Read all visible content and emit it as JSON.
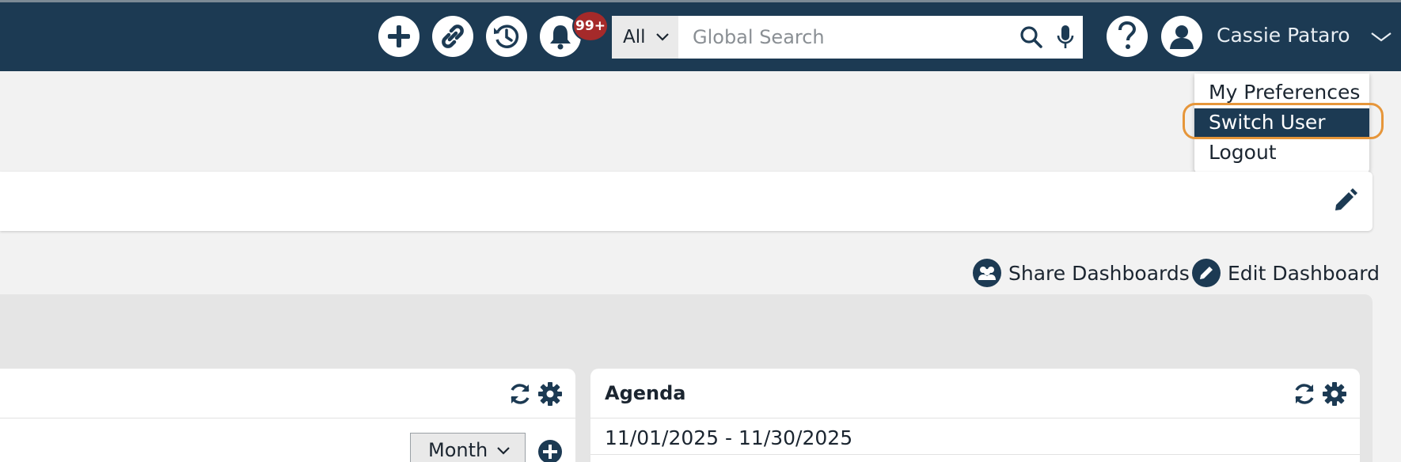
{
  "header": {
    "notification_count": "99+",
    "search": {
      "scope": "All",
      "placeholder": "Global Search"
    },
    "user_name": "Cassie Pataro",
    "icons": [
      "add-icon",
      "link-icon",
      "history-icon",
      "bell-icon",
      "search-icon",
      "microphone-icon",
      "help-icon",
      "avatar-icon",
      "chevron-down-icon"
    ]
  },
  "user_menu": {
    "items": [
      {
        "label": "My Preferences"
      },
      {
        "label": "Switch User"
      },
      {
        "label": "Logout"
      }
    ],
    "highlighted_item": "Switch User"
  },
  "actions": {
    "share": "Share Dashboards",
    "edit": "Edit Dashboard"
  },
  "widgets": {
    "left": {
      "view_select": "Month"
    },
    "agenda": {
      "title": "Agenda",
      "date_range": "11/01/2025 - 11/30/2025"
    }
  },
  "colors": {
    "header_bg": "#1c3a53",
    "badge": "#a52a2a",
    "highlight_ring": "#e6963a",
    "page_bg": "#f2f2f2"
  }
}
